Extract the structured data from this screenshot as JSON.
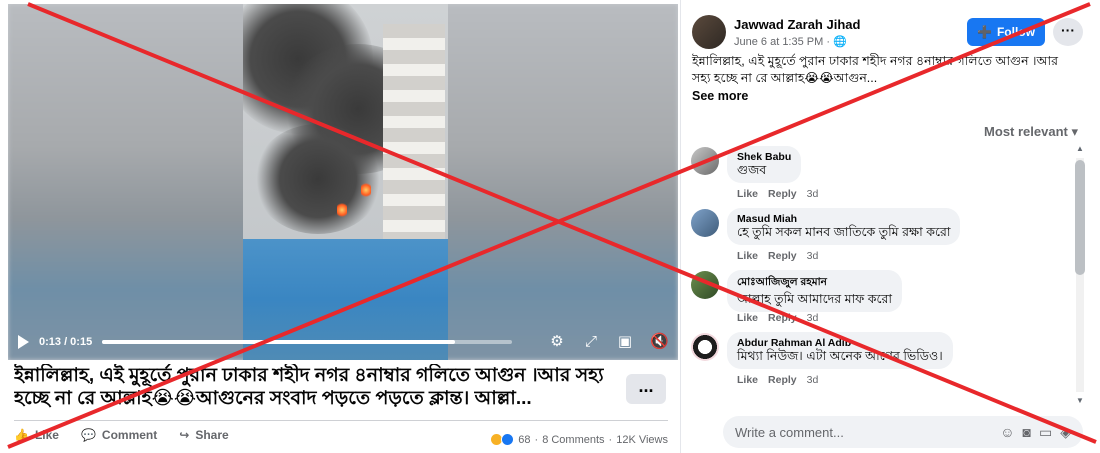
{
  "video": {
    "time_label": "0:13 / 0:15",
    "progress": 0.86
  },
  "post": {
    "caption": "ইন্নালিল্লাহ, এই মুহূর্তে পুরান ঢাকার শহীদ নগর ৪নাম্বার গলিতে আগুন ।আর সহ্য হচ্ছে না রে আল্লাহ😭😭আগুনের সংবাদ পড়তে পড়তে ক্লান্ত। আল্লা...",
    "more_label": "...",
    "actions": {
      "like": "Like",
      "comment": "Comment",
      "share": "Share"
    },
    "stats": {
      "reactions": "68",
      "comments": "8 Comments",
      "views": "12K Views",
      "separator": "·"
    }
  },
  "panel": {
    "author": "Jawwad Zarah Jihad",
    "time": "June 6 at 1:35 PM · 🌐",
    "follow_label": "Follow",
    "menu_label": "···",
    "text": "ইন্নালিল্লাহ, এই মুহূর্তে পুরান ঢাকার শহীদ নগর ৪নাম্বার গলিতে আগুন ।আর সহ্য হচ্ছে না রে আল্লাহ😭😭আগুন...",
    "see_more": "See more",
    "sort_label": "Most relevant ▾",
    "write_placeholder": "Write a comment...",
    "comments": [
      {
        "name": "Shek Babu",
        "text": "গুজব",
        "like": "Like",
        "reply": "Reply",
        "age": "3d"
      },
      {
        "name": "Masud Miah",
        "text": "হে তুমি সকল মানব জাতিকে তুমি রক্ষা করো",
        "like": "Like",
        "reply": "Reply",
        "age": "3d"
      },
      {
        "name": "মোঃআজিজুল রহমান",
        "text": "আল্লাহ তুমি আমাদের মাফ করো",
        "like": "Like",
        "reply": "Reply",
        "age": "3d"
      },
      {
        "name": "Abdur Rahman Al Adib",
        "text": "মিথ্যা নিউজ। এটা অনেক আগের ভিডিও।",
        "like": "Like",
        "reply": "Reply",
        "age": "3d"
      }
    ]
  },
  "colors": {
    "accent": "#1877f2",
    "overlay": "#e8282b"
  }
}
